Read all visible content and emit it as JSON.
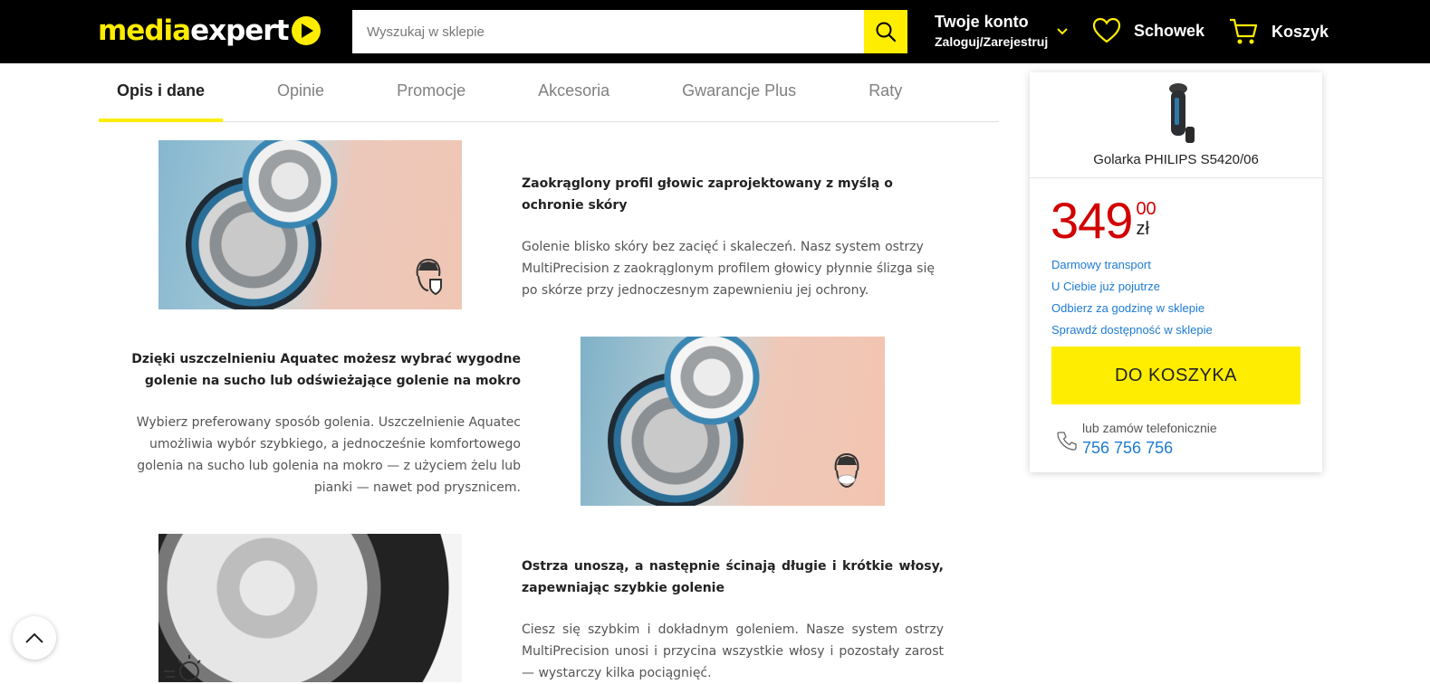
{
  "header": {
    "logo_part1": "media",
    "logo_part2": "expert",
    "search_placeholder": "Wyszukaj w sklepie",
    "account_title": "Twoje konto",
    "account_sub": "Zaloguj/Zarejestruj",
    "wishlist_label": "Schowek",
    "cart_label": "Koszyk"
  },
  "tabs": [
    {
      "label": "Opis i dane",
      "active": true
    },
    {
      "label": "Opinie"
    },
    {
      "label": "Promocje"
    },
    {
      "label": "Akcesoria"
    },
    {
      "label": "Gwarancje Plus"
    },
    {
      "label": "Raty"
    }
  ],
  "sections": [
    {
      "heading": "Zaokrąglony profil głowic zaprojektowany z myślą o ochronie skóry",
      "text": "Golenie blisko skóry bez zacięć i skaleczeń. Nasz system ostrzy MultiPrecision z zaokrąglonym profilem głowicy płynnie ślizga się po skórze przy jednoczesnym zapewnieniu jej ochrony."
    },
    {
      "heading": "Dzięki uszczelnieniu Aquatec możesz wybrać wygodne golenie na sucho lub odświeżające golenie na mokro",
      "text": "Wybierz preferowany sposób golenia. Uszczelnienie Aquatec umożliwia wybór szybkiego, a jednocześnie komfortowego golenia na sucho lub golenia na mokro — z użyciem żelu lub pianki — nawet pod prysznicem."
    },
    {
      "heading": "Ostrza unoszą, a następnie ścinają długie i krótkie włosy, zapewniając szybkie golenie",
      "text": "Ciesz się szybkim i dokładnym goleniem. Nasze system ostrzy MultiPrecision unosi i przycina wszystkie włosy i pozostały zarost — wystarczy kilka pociągnięć."
    }
  ],
  "product": {
    "name": "Golarka PHILIPS S5420/06",
    "price_main": "349",
    "price_cents": "00",
    "currency": "zł",
    "links": [
      "Darmowy transport",
      "U Ciebie już pojutrze",
      "Odbierz za godzinę w sklepie",
      "Sprawdź dostępność w sklepie"
    ],
    "add_to_cart": "DO KOSZYKA",
    "phone_label": "lub zamów telefonicznie",
    "phone_number": "756 756 756"
  },
  "colors": {
    "brand_yellow": "#ffed00",
    "header_bg": "#000000",
    "price_red": "#d20000",
    "link_blue": "#1e7bd1"
  }
}
